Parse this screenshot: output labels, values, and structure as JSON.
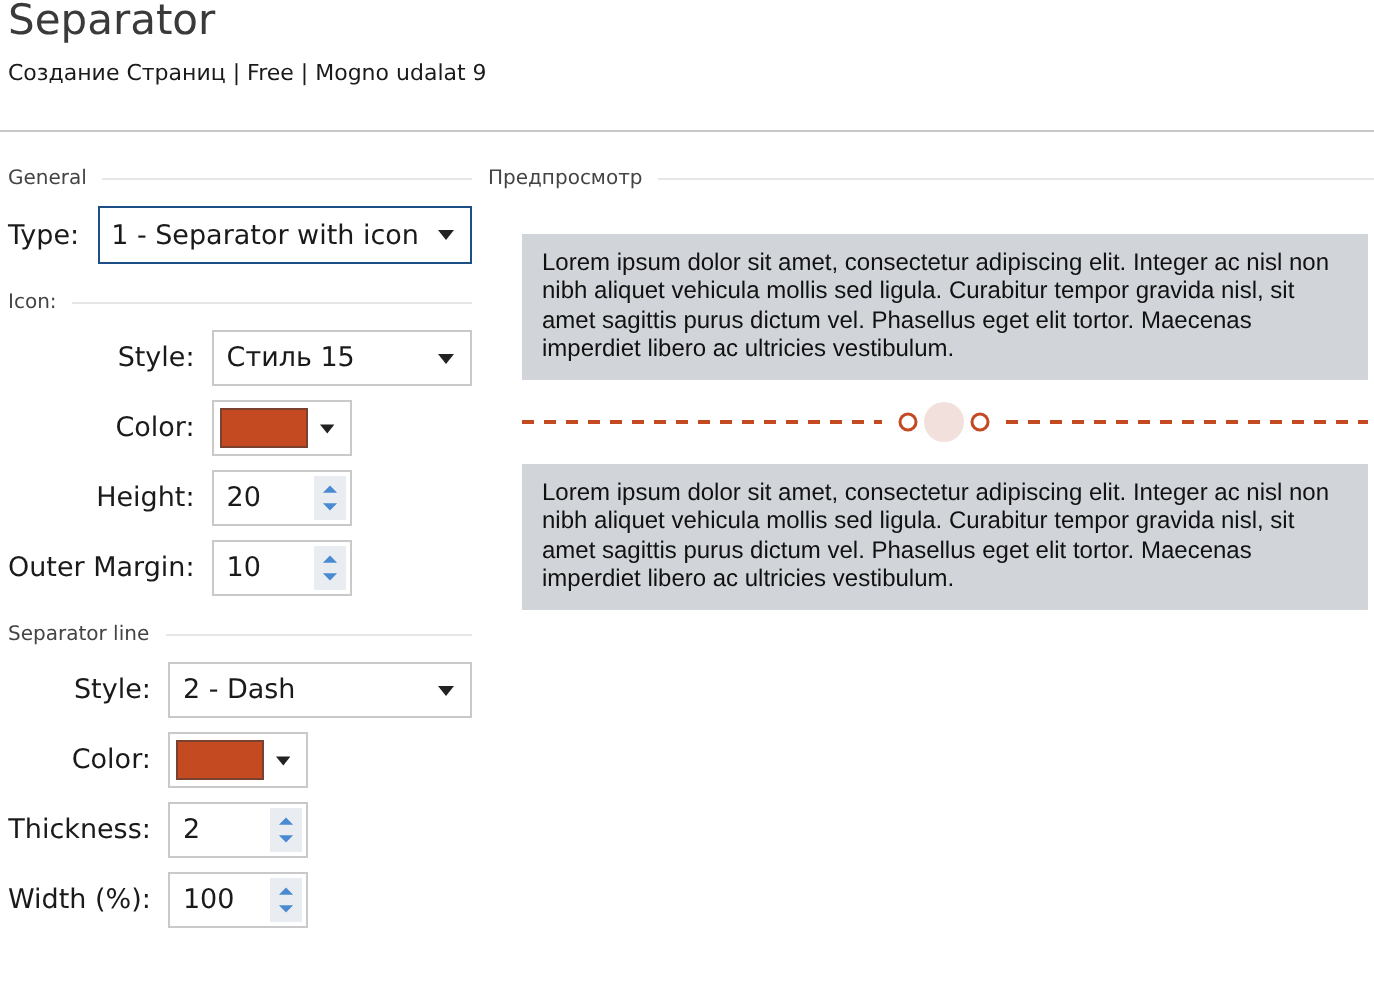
{
  "header": {
    "title": "Separator",
    "subtitle": "Создание Страниц | Free | Mogno udalat 9"
  },
  "settings": [
    {
      "heading": "General",
      "fields": [
        {
          "kind": "select",
          "label": "Type:",
          "value": "1 - Separator with icon",
          "highlighted": true
        }
      ]
    },
    {
      "heading": "Icon:",
      "fields": [
        {
          "kind": "select",
          "label": "Style:",
          "value": "Стиль 15",
          "highlighted": false
        },
        {
          "kind": "color",
          "label": "Color:",
          "color": "#c44a21"
        },
        {
          "kind": "number",
          "label": "Height:",
          "value": "20"
        },
        {
          "kind": "number",
          "label": "Outer Margin:",
          "value": "10"
        }
      ]
    },
    {
      "heading": "Separator line",
      "fields": [
        {
          "kind": "select",
          "label": "Style:",
          "value": "2 - Dash",
          "highlighted": false
        },
        {
          "kind": "color",
          "label": "Color:",
          "color": "#c44a21"
        },
        {
          "kind": "number",
          "label": "Thickness:",
          "value": "2"
        },
        {
          "kind": "number",
          "label": "Width (%):",
          "value": "100"
        }
      ]
    }
  ],
  "preview": {
    "heading": "Предпросмотр",
    "paragraphs": [
      "Lorem ipsum dolor sit amet, consectetur adipiscing elit. Integer ac nisl non nibh aliquet vehicula mollis sed ligula. Curabitur tempor gravida nisl, sit amet sagittis purus dictum vel. Phasellus eget elit tortor. Maecenas imperdiet libero ac ultricies vestibulum.",
      "Lorem ipsum dolor sit amet, consectetur adipiscing elit. Integer ac nisl non nibh aliquet vehicula mollis sed ligula. Curabitur tempor gravida nisl, sit amet sagittis purus dictum vel. Phasellus eget elit tortor. Maecenas imperdiet libero ac ultricies vestibulum."
    ],
    "separator": {
      "color": "#c44a21"
    }
  }
}
